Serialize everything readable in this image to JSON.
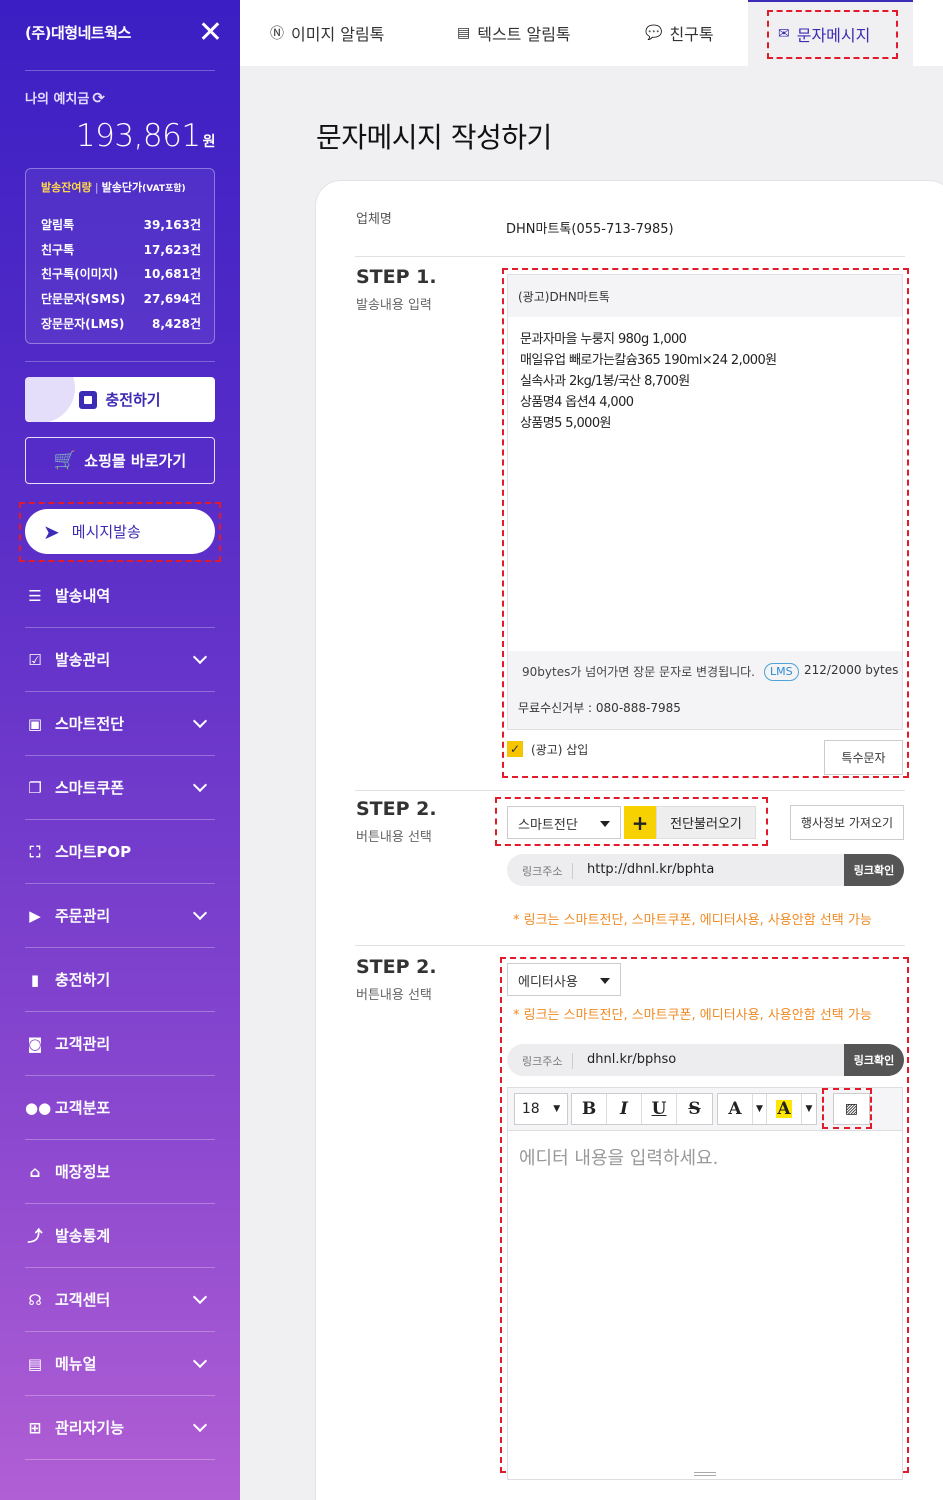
{
  "sidebar": {
    "company": "(주)대형네트웍스",
    "deposit_label": "나의 예치금",
    "deposit_amount": "193,861",
    "deposit_unit": "원",
    "balance_head": "발송잔여량",
    "price_head": "발송단가",
    "vat_note": "(VAT포함)",
    "balances": [
      {
        "label": "알림톡",
        "value": "39,163건"
      },
      {
        "label": "친구톡",
        "value": "17,623건"
      },
      {
        "label": "친구톡(이미지)",
        "value": "10,681건"
      },
      {
        "label": "단문문자(SMS)",
        "value": "27,694건"
      },
      {
        "label": "장문문자(LMS)",
        "value": "8,428건"
      }
    ],
    "charge_button": "충전하기",
    "shop_button": "쇼핑몰 바로가기",
    "send_button": "메시지발송",
    "nav": [
      {
        "label": "발송내역",
        "icon": "list-icon"
      },
      {
        "label": "발송관리",
        "icon": "checklist-icon"
      },
      {
        "label": "스마트전단",
        "icon": "image-icon"
      },
      {
        "label": "스마트쿠폰",
        "icon": "coupon-icon"
      },
      {
        "label": "스마트POP",
        "icon": "pop-icon"
      },
      {
        "label": "주문관리",
        "icon": "order-icon"
      },
      {
        "label": "충전하기",
        "icon": "battery-icon"
      },
      {
        "label": "고객관리",
        "icon": "contact-icon"
      },
      {
        "label": "고객분포",
        "icon": "group-icon"
      },
      {
        "label": "매장정보",
        "icon": "store-icon"
      },
      {
        "label": "발송통계",
        "icon": "stats-icon"
      },
      {
        "label": "고객센터",
        "icon": "headset-icon"
      },
      {
        "label": "메뉴얼",
        "icon": "manual-icon"
      },
      {
        "label": "관리자기능",
        "icon": "admin-icon"
      }
    ]
  },
  "tabs": [
    {
      "label": "이미지 알림톡",
      "icon": "n-circle-icon"
    },
    {
      "label": "텍스트 알림톡",
      "icon": "message-icon"
    },
    {
      "label": "친구톡",
      "icon": "chat-icon"
    },
    {
      "label": "문자메시지",
      "icon": "mail-icon"
    }
  ],
  "page_title": "문자메시지 작성하기",
  "business": {
    "label": "업체명",
    "value": "DHN마트톡(055-713-7985)"
  },
  "step1": {
    "title": "STEP 1.",
    "subtitle": "발송내용 입력",
    "header_text": "(광고)DHN마트톡",
    "body_lines": [
      "문과자마을 누룽지 980g 1,000",
      "매일유업 빼로가는칼슘365 190ml×24 2,000원",
      "실속사과 2kg/1봉/국산 8,700원",
      "상품명4 옵션4 4,000",
      "상품명5 5,000원"
    ],
    "info": "90bytes가 넘어가면 장문 문자로 변경됩니다.",
    "lms_badge": "LMS",
    "bytes": "212/2000 bytes",
    "reject": "무료수신거부 : 080-888-7985",
    "ad_insert_label": "(광고) 삽입",
    "ad_insert_checked": "✓",
    "special_char_button": "특수문자"
  },
  "step2": {
    "title": "STEP 2.",
    "subtitle": "버튼내용 선택",
    "select_value": "스마트전단",
    "load_button": "전단불러오기",
    "event_button": "행사정보 가져오기",
    "link_label": "링크주소",
    "link_url": "http://dhnl.kr/bphta",
    "link_check": "링크확인",
    "note": "* 링크는 스마트전단, 스마트쿠폰, 에디터사용, 사용안함 선택 가능"
  },
  "step3": {
    "title": "STEP 2.",
    "subtitle": "버튼내용 선택",
    "select_value": "에디터사용",
    "note": "* 링크는 스마트전단, 스마트쿠폰, 에디터사용, 사용안함 선택 가능",
    "link_label": "링크주소",
    "link_url": "dhnl.kr/bphso",
    "link_check": "링크확인",
    "font_size": "18",
    "editor_placeholder": "에디터 내용을 입력하세요."
  }
}
